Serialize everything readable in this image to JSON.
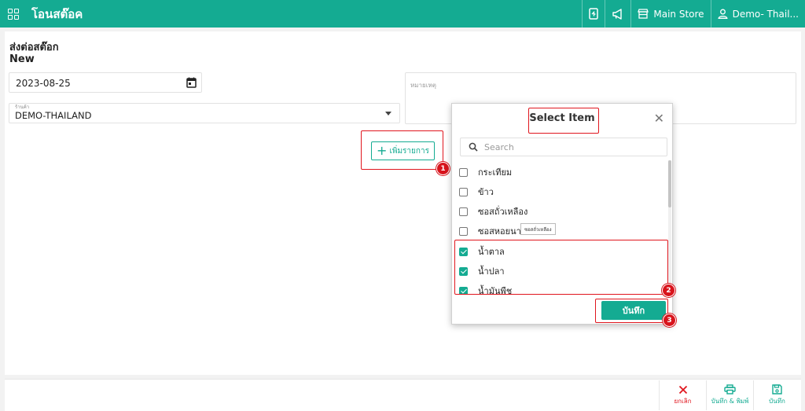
{
  "header": {
    "app_title": "โอนสต๊อค",
    "store": "Main Store",
    "user": "Demo- Thail..."
  },
  "page": {
    "title": "ส่งต่อสต๊อก",
    "status": "New"
  },
  "form": {
    "date_value": "2023-08-25",
    "store_label": "ร้านค้า",
    "store_value": "DEMO-THAILAND",
    "note_label": "หมายเหตุ",
    "add_item_label": "เพิ่มรายการ"
  },
  "modal": {
    "title": "Select Item",
    "search_placeholder": "Search",
    "items": [
      {
        "label": "กระเทียม",
        "checked": false
      },
      {
        "label": "ข้าว",
        "checked": false
      },
      {
        "label": "ซอสถั่วเหลือง",
        "checked": false
      },
      {
        "label": "ซอสหอยนา",
        "checked": false
      },
      {
        "label": "น้ำตาล",
        "checked": true
      },
      {
        "label": "น้ำปลา",
        "checked": true
      },
      {
        "label": "น้ำมันพืช",
        "checked": true
      }
    ],
    "tooltip": "ซอสถั่วเหลือง",
    "save_label": "บันทึก"
  },
  "annotations": {
    "badge_1": "1",
    "badge_2": "2",
    "badge_3": "3"
  },
  "footer": {
    "cancel_label": "ยกเลิก",
    "save_print_label": "บันทึก & พิมพ์",
    "save_label": "บันทึก"
  },
  "colors": {
    "brand": "#14ab92",
    "annotation": "#e0161e",
    "cancel": "#e0161e"
  }
}
